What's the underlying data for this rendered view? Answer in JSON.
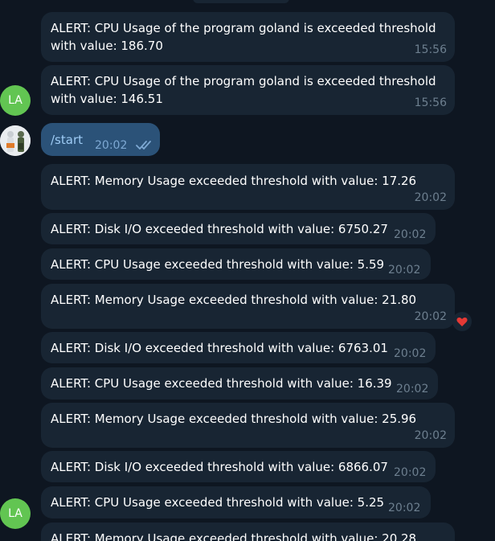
{
  "chat": {
    "messages": [
      {
        "text": "ALERT: CPU Usage of the program goland is exceeded threshold",
        "text2": "with value: 186.70",
        "time": "15:56"
      },
      {
        "text": "ALERT: CPU Usage of the program goland is exceeded threshold",
        "text2": "with value: 146.51",
        "time": "15:56",
        "avatar": "LA"
      },
      {
        "text": "/start",
        "time": "20:02",
        "read": "double-check-icon"
      },
      {
        "text": "ALERT: Memory Usage exceeded threshold with value: 17.26",
        "time": "20:02"
      },
      {
        "text": "ALERT: Disk I/O exceeded threshold with value: 6750.27",
        "time": "20:02"
      },
      {
        "text": "ALERT: CPU Usage exceeded threshold with value: 5.59",
        "time": "20:02"
      },
      {
        "text": "ALERT: Memory Usage exceeded threshold with value: 21.80",
        "time": "20:02",
        "reaction": "heart-icon"
      },
      {
        "text": "ALERT: Disk I/O exceeded threshold with value: 6763.01",
        "time": "20:02"
      },
      {
        "text": "ALERT: CPU Usage exceeded threshold with value: 16.39",
        "time": "20:02"
      },
      {
        "text": "ALERT: Memory Usage exceeded threshold with value: 25.96",
        "time": "20:02"
      },
      {
        "text": "ALERT: Disk I/O exceeded threshold with value: 6866.07",
        "time": "20:02"
      },
      {
        "text": "ALERT: CPU Usage exceeded threshold with value: 5.25",
        "time": "20:02",
        "avatar": "LA"
      },
      {
        "text": "ALERT: Memory Usage exceeded threshold with value: 20.28"
      }
    ]
  },
  "colors": {
    "background": "#0e1621",
    "incoming_bubble": "#182533",
    "outgoing_bubble": "#2b5278",
    "avatar_green": "#62c552",
    "reaction_heart": "#e53935"
  }
}
